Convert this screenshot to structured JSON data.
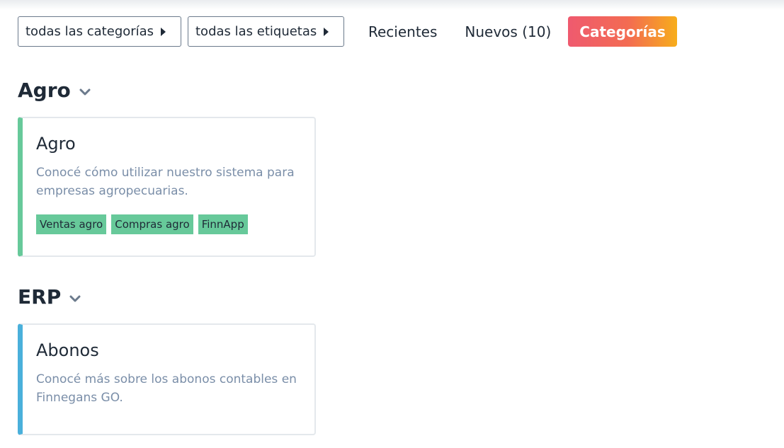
{
  "nav": {
    "categories_dropdown": "todas las categorías",
    "tags_dropdown": "todas las etiquetas",
    "recent": "Recientes",
    "new": "Nuevos (10)",
    "categories": "Categorías"
  },
  "colors": {
    "agro_accent": "#67c99a",
    "erp_accent": "#4ab0db",
    "active_tab_gradient_start": "#ef5a6f",
    "active_tab_gradient_end": "#f7ad1b",
    "tag_bg": "#67c99a"
  },
  "sections": [
    {
      "heading": "Agro",
      "cards": [
        {
          "title": "Agro",
          "description": "Conocé cómo utilizar nuestro sistema para empresas agropecuarias.",
          "tags": [
            "Ventas agro",
            "Compras agro",
            "FinnApp"
          ]
        }
      ]
    },
    {
      "heading": "ERP",
      "cards": [
        {
          "title": "Abonos",
          "description": "Conocé más sobre los abonos contables en Finnegans GO.",
          "tags": []
        }
      ]
    }
  ]
}
